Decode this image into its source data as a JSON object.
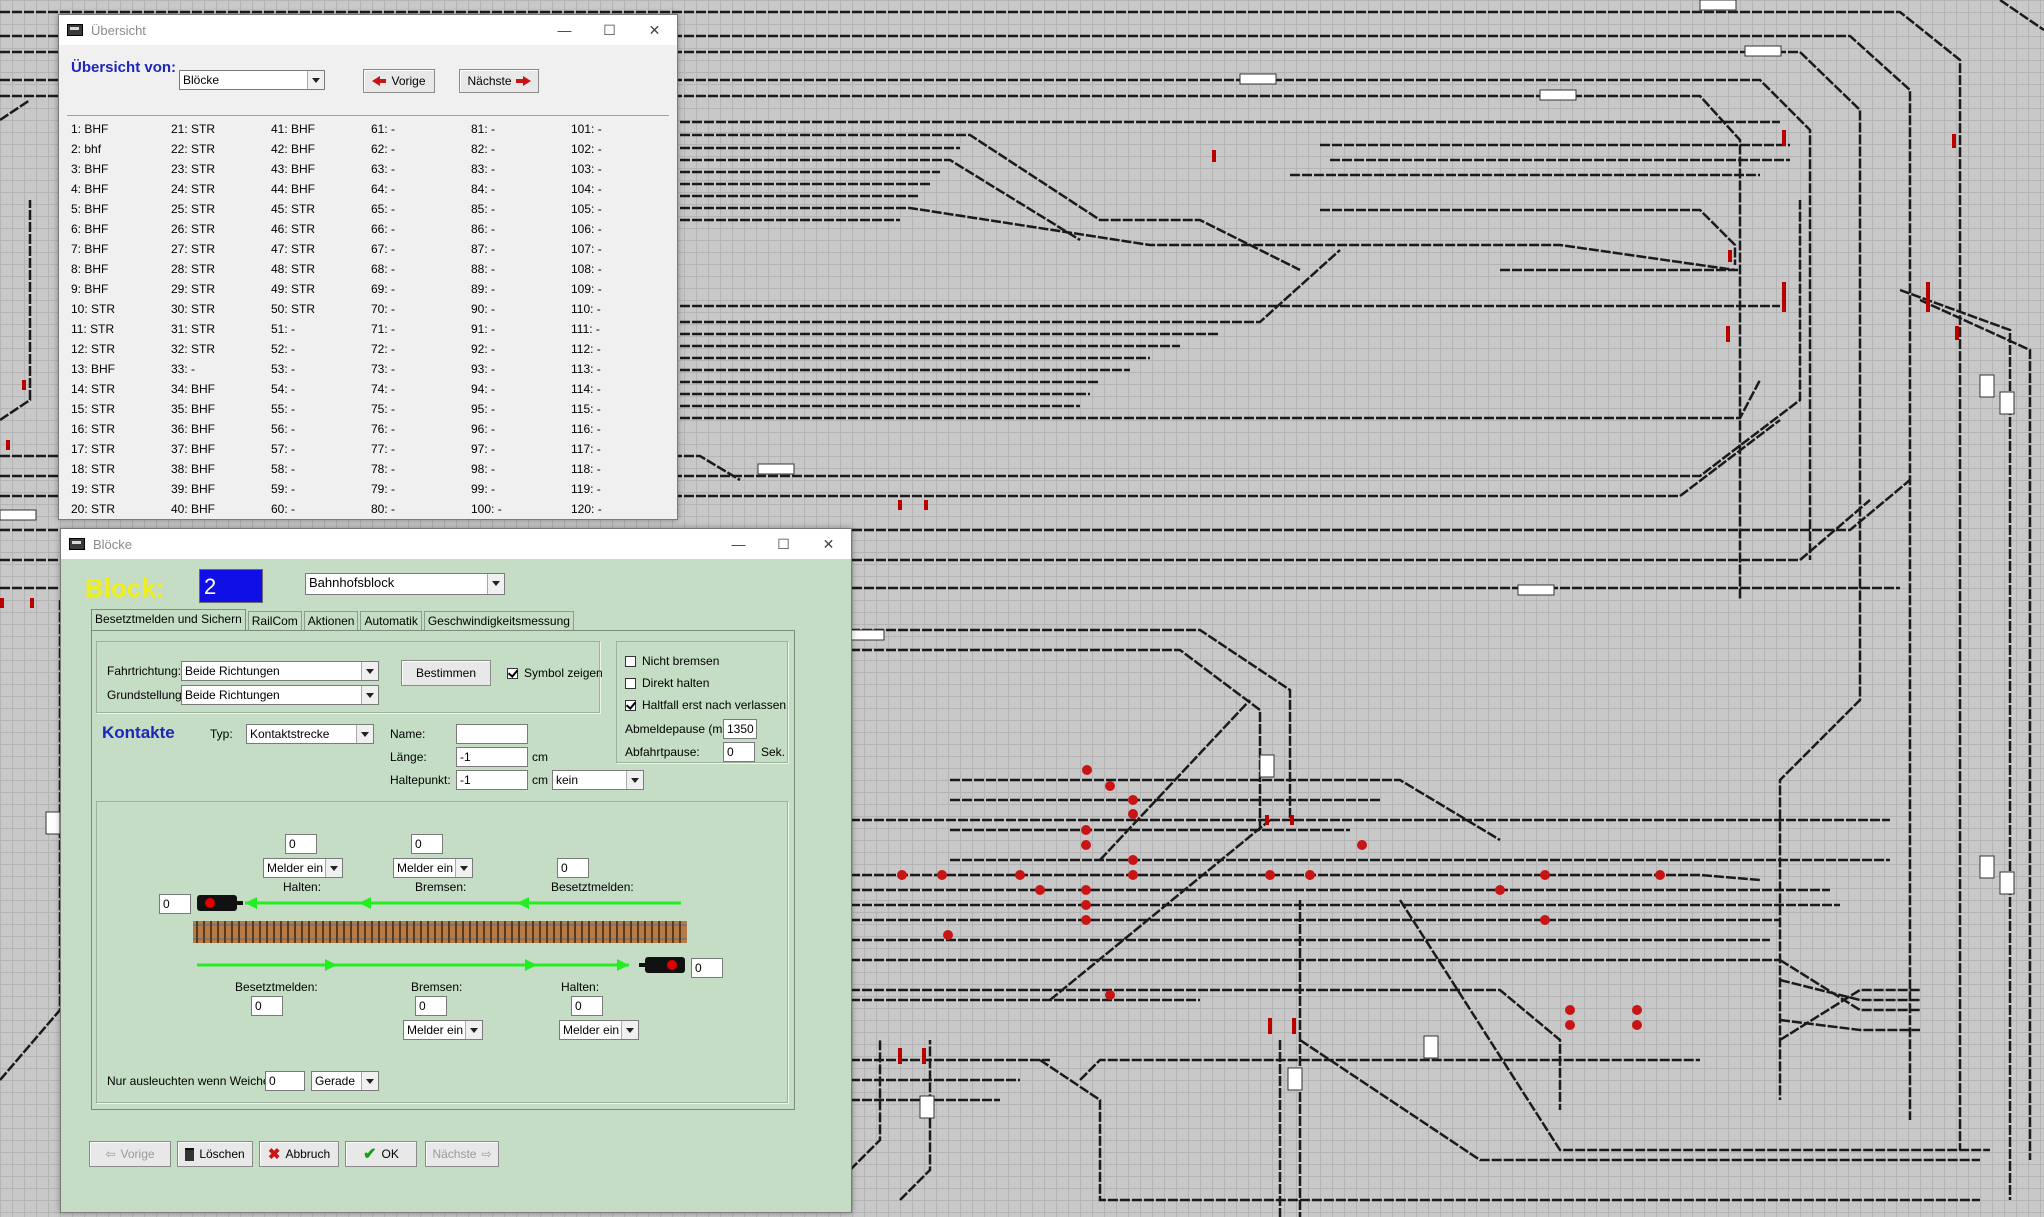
{
  "overview_window": {
    "title": "Übersicht",
    "label": "Übersicht von:",
    "selected": "Blöcke",
    "prev_label": "Vorige",
    "next_label": "Nächste",
    "columns": [
      [
        "1: BHF",
        "2: bhf",
        "3: BHF",
        "4: BHF",
        "5: BHF",
        "6: BHF",
        "7: BHF",
        "8: BHF",
        "9: BHF",
        "10: STR",
        "11: STR",
        "12: STR",
        "13: BHF",
        "14: STR",
        "15: STR",
        "16: STR",
        "17: STR",
        "18: STR",
        "19: STR",
        "20: STR"
      ],
      [
        "21: STR",
        "22: STR",
        "23: STR",
        "24: STR",
        "25: STR",
        "26: STR",
        "27: STR",
        "28: STR",
        "29: STR",
        "30: STR",
        "31: STR",
        "32: STR",
        "33: -",
        "34: BHF",
        "35: BHF",
        "36: BHF",
        "37: BHF",
        "38: BHF",
        "39: BHF",
        "40: BHF"
      ],
      [
        "41: BHF",
        "42: BHF",
        "43: BHF",
        "44: BHF",
        "45: STR",
        "46: STR",
        "47: STR",
        "48: STR",
        "49: STR",
        "50: STR",
        "51: -",
        "52: -",
        "53: -",
        "54: -",
        "55: -",
        "56: -",
        "57: -",
        "58: -",
        "59: -",
        "60: -"
      ],
      [
        "61: -",
        "62: -",
        "63: -",
        "64: -",
        "65: -",
        "66: -",
        "67: -",
        "68: -",
        "69: -",
        "70: -",
        "71: -",
        "72: -",
        "73: -",
        "74: -",
        "75: -",
        "76: -",
        "77: -",
        "78: -",
        "79: -",
        "80: -"
      ],
      [
        "81: -",
        "82: -",
        "83: -",
        "84: -",
        "85: -",
        "86: -",
        "87: -",
        "88: -",
        "89: -",
        "90: -",
        "91: -",
        "92: -",
        "93: -",
        "94: -",
        "95: -",
        "96: -",
        "97: -",
        "98: -",
        "99: -",
        "100: -"
      ],
      [
        "101: -",
        "102: -",
        "103: -",
        "104: -",
        "105: -",
        "106: -",
        "107: -",
        "108: -",
        "109: -",
        "110: -",
        "111: -",
        "112: -",
        "113: -",
        "114: -",
        "115: -",
        "116: -",
        "117: -",
        "118: -",
        "119: -",
        "120: -"
      ]
    ]
  },
  "blocks_window": {
    "title": "Blöcke",
    "block_label": "Block:",
    "block_number": "2",
    "block_type": "Bahnhofsblock",
    "tabs": [
      "Besetztmelden und Sichern",
      "RailCom",
      "Aktionen",
      "Automatik",
      "Geschwindigkeitsmessung"
    ],
    "fahrtrichtung_label": "Fahrtrichtung:",
    "fahrtrichtung_value": "Beide Richtungen",
    "grundstellung_label": "Grundstellung:",
    "grundstellung_value": "Beide Richtungen",
    "bestimmen_label": "Bestimmen",
    "symbol_zeigen_label": "Symbol zeigen",
    "nicht_bremsen_label": "Nicht bremsen",
    "direkt_halten_label": "Direkt halten",
    "haltfall_label": "Haltfall erst nach verlassen",
    "abmeldepause_label": "Abmeldepause (ms):",
    "abmeldepause_value": "1350",
    "abfahrtpause_label": "Abfahrtpause:",
    "abfahrtpause_value": "0",
    "abfahrtpause_unit": "Sek.",
    "kontakte_label": "Kontakte",
    "typ_label": "Typ:",
    "typ_value": "Kontaktstrecke",
    "name_label": "Name:",
    "name_value": "",
    "laenge_label": "Länge:",
    "laenge_value": "-1",
    "haltepunkt_label": "Haltepunkt:",
    "haltepunkt_value": "-1",
    "cm_unit": "cm",
    "haltepunkt_option": "kein",
    "top_halten_value": "0",
    "top_halten_melder": "Melder ein",
    "top_bremsen_value": "0",
    "top_bremsen_melder": "Melder ein",
    "top_besetzt_value": "0",
    "halten_label": "Halten:",
    "bremsen_label": "Bremsen:",
    "besetztmelden_label": "Besetztmelden:",
    "left_signal_value": "0",
    "right_signal_value": "0",
    "bot_besetzt_value": "0",
    "bot_bremsen_value": "0",
    "bot_bremsen_melder": "Melder ein",
    "bot_halten_value": "0",
    "bot_halten_melder": "Melder ein",
    "weiche_label": "Nur ausleuchten wenn Weiche:",
    "weiche_value": "0",
    "weiche_option": "Gerade",
    "btn_vorige": "Vorige",
    "btn_loeschen": "Löschen",
    "btn_abbruch": "Abbruch",
    "btn_ok": "OK",
    "btn_naechste": "Nächste"
  },
  "colors": {
    "track": "#1a1a1a",
    "signal_red": "#c80000",
    "arrow_green": "#22ee22",
    "block_blue": "#1010e6",
    "label_yellow": "#f0ef1a",
    "label_blue": "#1d26b8"
  }
}
